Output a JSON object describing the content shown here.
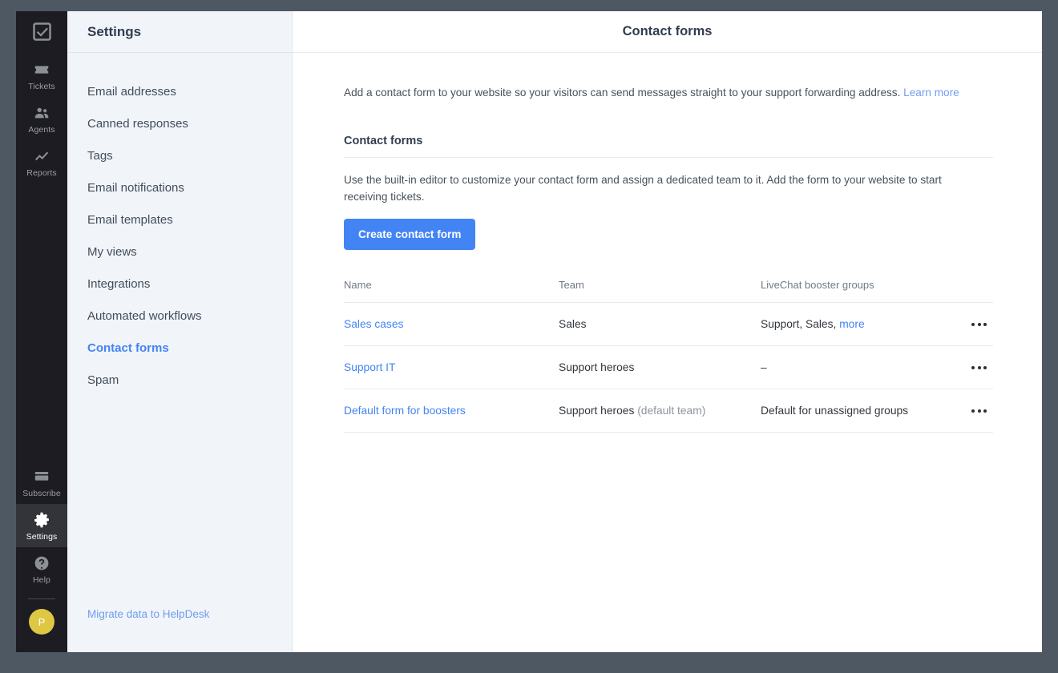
{
  "rail": {
    "logo_icon": "check-square-logo-icon",
    "items": [
      {
        "label": "Tickets",
        "icon": "ticket-icon",
        "active": false
      },
      {
        "label": "Agents",
        "icon": "agents-icon",
        "active": false
      },
      {
        "label": "Reports",
        "icon": "reports-icon",
        "active": false
      }
    ],
    "bottom_items": [
      {
        "label": "Subscribe",
        "icon": "credit-card-icon",
        "active": false
      },
      {
        "label": "Settings",
        "icon": "gear-icon",
        "active": true
      },
      {
        "label": "Help",
        "icon": "help-circle-icon",
        "active": false
      }
    ],
    "avatar_initial": "P"
  },
  "settings_nav": {
    "title": "Settings",
    "items": [
      {
        "label": "Email addresses",
        "active": false
      },
      {
        "label": "Canned responses",
        "active": false
      },
      {
        "label": "Tags",
        "active": false
      },
      {
        "label": "Email notifications",
        "active": false
      },
      {
        "label": "Email templates",
        "active": false
      },
      {
        "label": "My views",
        "active": false
      },
      {
        "label": "Integrations",
        "active": false
      },
      {
        "label": "Automated workflows",
        "active": false
      },
      {
        "label": "Contact forms",
        "active": true
      },
      {
        "label": "Spam",
        "active": false
      }
    ],
    "footer_link": "Migrate data to HelpDesk"
  },
  "main": {
    "header_title": "Contact forms",
    "intro_text": "Add a contact form to your website so your visitors can send messages straight to your support forwarding address.",
    "intro_link": "Learn more",
    "section_title": "Contact forms",
    "section_desc": "Use the built-in editor to customize your contact form and assign a dedicated team to it. Add the form to your website to start receiving tickets.",
    "create_button": "Create contact form",
    "table": {
      "headers": [
        "Name",
        "Team",
        "LiveChat booster groups"
      ],
      "rows": [
        {
          "name": "Sales cases",
          "team": "Sales",
          "team_suffix": "",
          "groups": "Support, Sales,",
          "groups_link": "more",
          "menu_icon": "ellipsis-icon"
        },
        {
          "name": "Support IT",
          "team": "Support heroes",
          "team_suffix": "",
          "groups": "–",
          "groups_link": "",
          "menu_icon": "ellipsis-icon"
        },
        {
          "name": "Default form for boosters",
          "team": "Support heroes",
          "team_suffix": "(default team)",
          "groups": "Default for unassigned groups",
          "groups_link": "",
          "menu_icon": "ellipsis-icon"
        }
      ]
    }
  },
  "colors": {
    "accent": "#4384f5",
    "rail_bg": "#1c1c22",
    "nav_bg": "#f1f4f8",
    "avatar": "#dec742",
    "backdrop": "#4e5862"
  }
}
